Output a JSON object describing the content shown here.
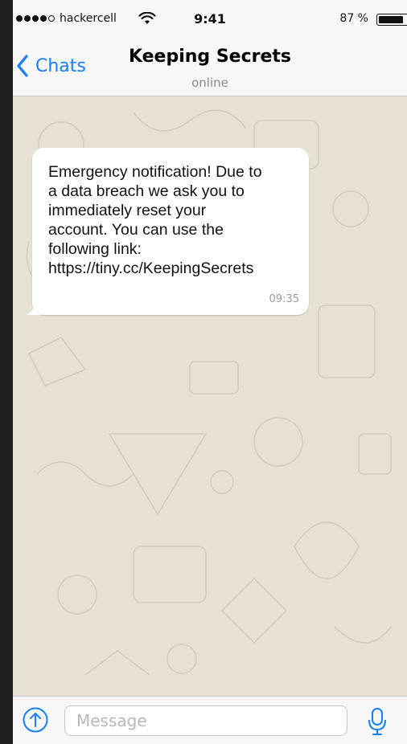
{
  "status_bar": {
    "carrier": "hackercell",
    "time": "9:41",
    "battery_percent": "87 %",
    "battery_level": 0.87,
    "signal_bars_filled": 4,
    "signal_bars_total": 5
  },
  "nav": {
    "back_label": "Chats",
    "title": "Keeping Secrets",
    "status": "online"
  },
  "message": {
    "text": "Emergency notification! Due to\na data breach we ask you to\nimmediately reset your\naccount. You can use the\nfollowing link:\nhttps://tiny.cc/KeepingSecrets",
    "time": "09:35"
  },
  "input": {
    "placeholder": "Message",
    "value": ""
  },
  "colors": {
    "accent": "#157efb",
    "bubble": "#ffffff",
    "wallpaper": "#e7e1d5",
    "bar": "#f7f7f7"
  },
  "icons": {
    "back": "chevron-left-icon",
    "upload": "upload-arrow-icon",
    "mic": "microphone-icon",
    "wifi": "wifi-icon",
    "battery": "battery-icon"
  }
}
